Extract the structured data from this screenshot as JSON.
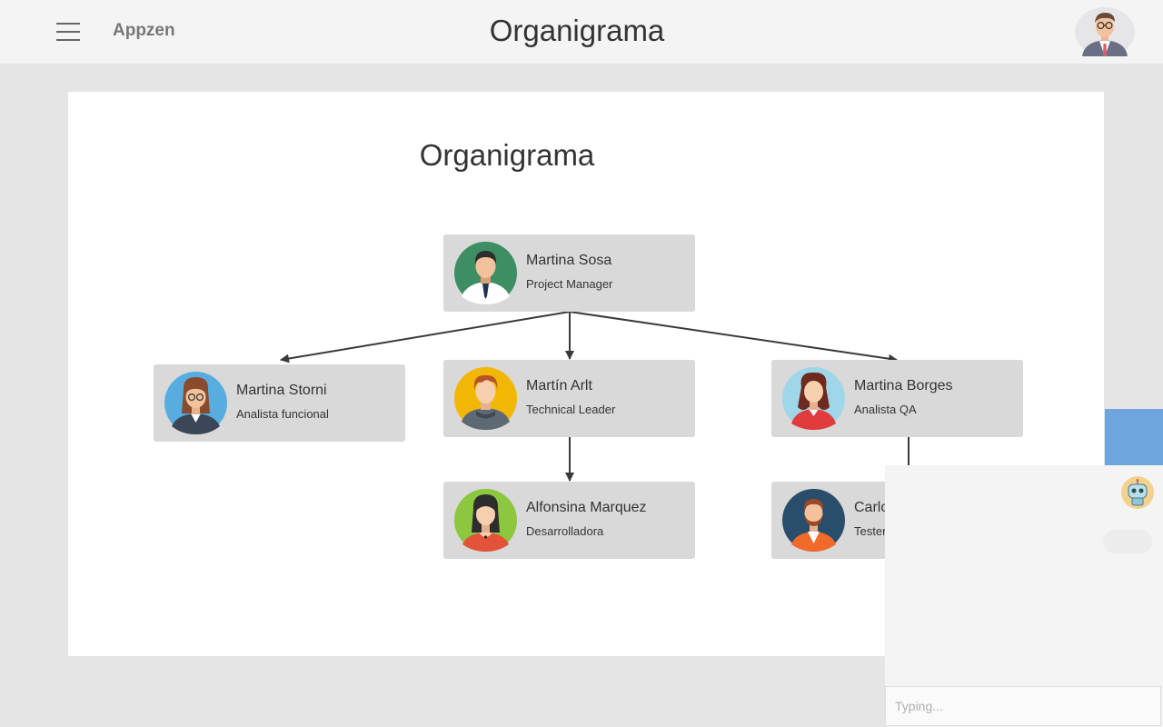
{
  "header": {
    "brand": "Appzen",
    "title": "Organigrama",
    "menu_icon": "hamburger-menu-icon",
    "user_avatar": "user-avatar"
  },
  "main": {
    "title": "Organigrama",
    "nodes": [
      {
        "name": "Martina Sosa",
        "role": "Project Manager",
        "avatar_bg": "#3e8e63"
      },
      {
        "name": "Martina Storni",
        "role": "Analista funcional",
        "avatar_bg": "#58ade0"
      },
      {
        "name": "Martín Arlt",
        "role": "Technical Leader",
        "avatar_bg": "#f2b705"
      },
      {
        "name": "Martina Borges",
        "role": "Analista QA",
        "avatar_bg": "#9fd6e9"
      },
      {
        "name": "Alfonsina Marquez",
        "role": "Desarrolladora",
        "avatar_bg": "#8dc63f"
      },
      {
        "name": "Carlos Cortazar",
        "role": "Tester Junior",
        "avatar_bg": "#2a4d6b"
      }
    ]
  },
  "chat": {
    "input_placeholder": "Typing...",
    "tab_color": "#6ea5dd",
    "bot_icon": "robot-icon"
  },
  "colors": {
    "topbar": "#f4f4f4",
    "background": "#e5e5e5",
    "node": "#d9d9d9",
    "connector": "#3a3a3a"
  }
}
